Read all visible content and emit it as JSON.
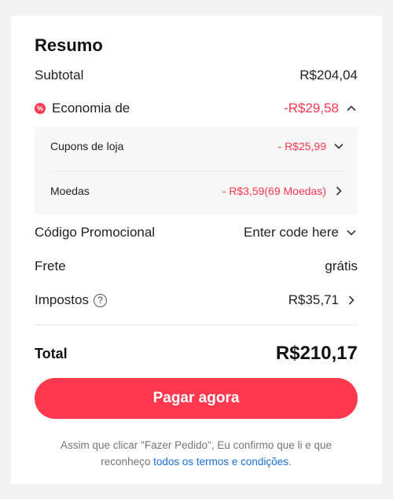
{
  "summary": {
    "title": "Resumo",
    "subtotal_label": "Subtotal",
    "subtotal_value": "R$204,04",
    "economy_badge": "%",
    "economy_label": "Economia de",
    "economy_value": "-R$29,58",
    "economy_items": [
      {
        "label": "Cupons de loja",
        "value": "- R$25,99"
      },
      {
        "label": "Moedas",
        "value": "- R$3,59(69 Moedas)"
      }
    ],
    "promo_label": "Código Promocional",
    "promo_placeholder": "Enter code here",
    "shipping_label": "Frete",
    "shipping_value": "grátis",
    "taxes_label": "Impostos",
    "taxes_help": "?",
    "taxes_value": "R$35,71",
    "total_label": "Total",
    "total_value": "R$210,17"
  },
  "pay_button": "Pagar agora",
  "terms": {
    "text_before": "Assim que clicar \"Fazer Pedido\", Eu confirmo que li e que reconheço ",
    "link_text": "todos os termos e condições",
    "text_after": "."
  },
  "colors": {
    "accent": "#fd384f",
    "link": "#1a6fd8"
  },
  "icons": [
    "discount-badge-icon",
    "chevron-up-icon",
    "chevron-down-icon",
    "chevron-right-icon",
    "help-icon"
  ]
}
